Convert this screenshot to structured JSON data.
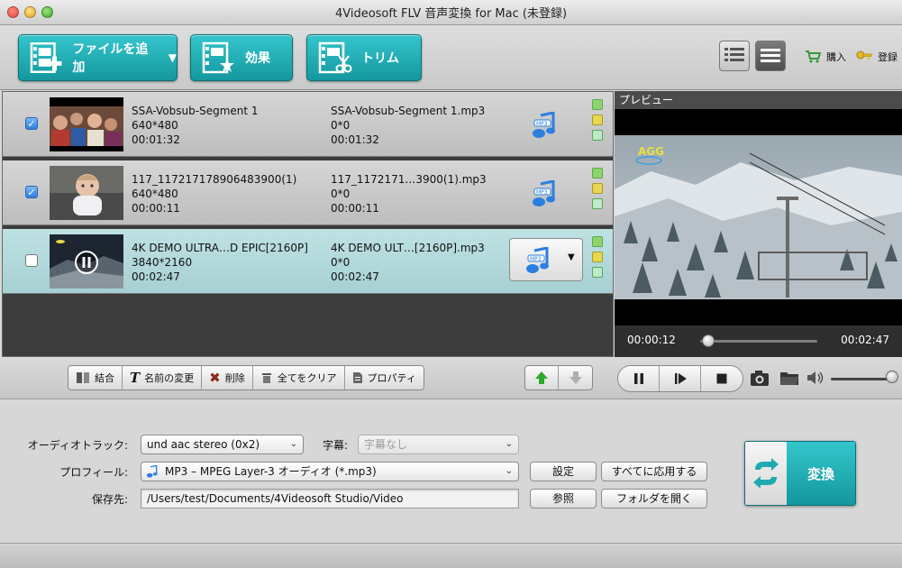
{
  "window": {
    "title": "4Videosoft FLV 音声変換 for Mac (未登録)"
  },
  "toolbar": {
    "add_file": "ファイルを追加",
    "effect": "効果",
    "trim": "トリム",
    "buy": "購入",
    "register": "登録"
  },
  "files": [
    {
      "name": "SSA-Vobsub-Segment 1",
      "resolution": "640*480",
      "duration": "00:01:32",
      "out_name": "SSA-Vobsub-Segment 1.mp3",
      "out_res": "0*0",
      "out_duration": "00:01:32",
      "checked": true
    },
    {
      "name": "117_117217178906483900(1)",
      "resolution": "640*480",
      "duration": "00:00:11",
      "out_name": "117_1172171…3900(1).mp3",
      "out_res": "0*0",
      "out_duration": "00:00:11",
      "checked": true
    },
    {
      "name": "4K DEMO ULTRA…D EPIC[2160P]",
      "resolution": "3840*2160",
      "duration": "00:02:47",
      "out_name": "4K DEMO ULT…[2160P].mp3",
      "out_res": "0*0",
      "out_duration": "00:02:47",
      "checked": false
    }
  ],
  "editbar": {
    "merge": "結合",
    "rename": "名前の変更",
    "delete": "削除",
    "clear_all": "全てをクリア",
    "properties": "プロパティ"
  },
  "preview": {
    "title": "プレビュー",
    "current_time": "00:00:12",
    "total_time": "00:02:47",
    "progress_fraction": 0.07,
    "volume_fraction": 0.95,
    "logo_text": "AGG"
  },
  "settings": {
    "audio_track_label": "オーディオトラック:",
    "audio_track_value": "und aac stereo (0x2)",
    "subtitle_label": "字幕:",
    "subtitle_value": "字幕なし",
    "profile_label": "プロフィール:",
    "profile_value": "MP3 – MPEG Layer-3 オーディオ (*.mp3)",
    "save_label": "保存先:",
    "save_value": "/Users/test/Documents/4Videosoft Studio/Video",
    "settings_btn": "設定",
    "apply_all_btn": "すべてに応用する",
    "browse_btn": "参照",
    "open_folder_btn": "フォルダを開く",
    "convert_btn": "変換"
  },
  "colors": {
    "accent": "#1fa9b0",
    "accent_dark": "#0b6f75",
    "selected_row": "#b3d8db"
  },
  "icons": [
    "film-add-icon",
    "film-effect-icon",
    "film-trim-icon",
    "list-view-icon",
    "detail-view-icon",
    "cart-icon",
    "key-icon",
    "mp3-note-icon",
    "pause-icon",
    "step-icon",
    "stop-icon",
    "camera-icon",
    "folder-icon",
    "speaker-icon",
    "convert-arrows-icon"
  ]
}
